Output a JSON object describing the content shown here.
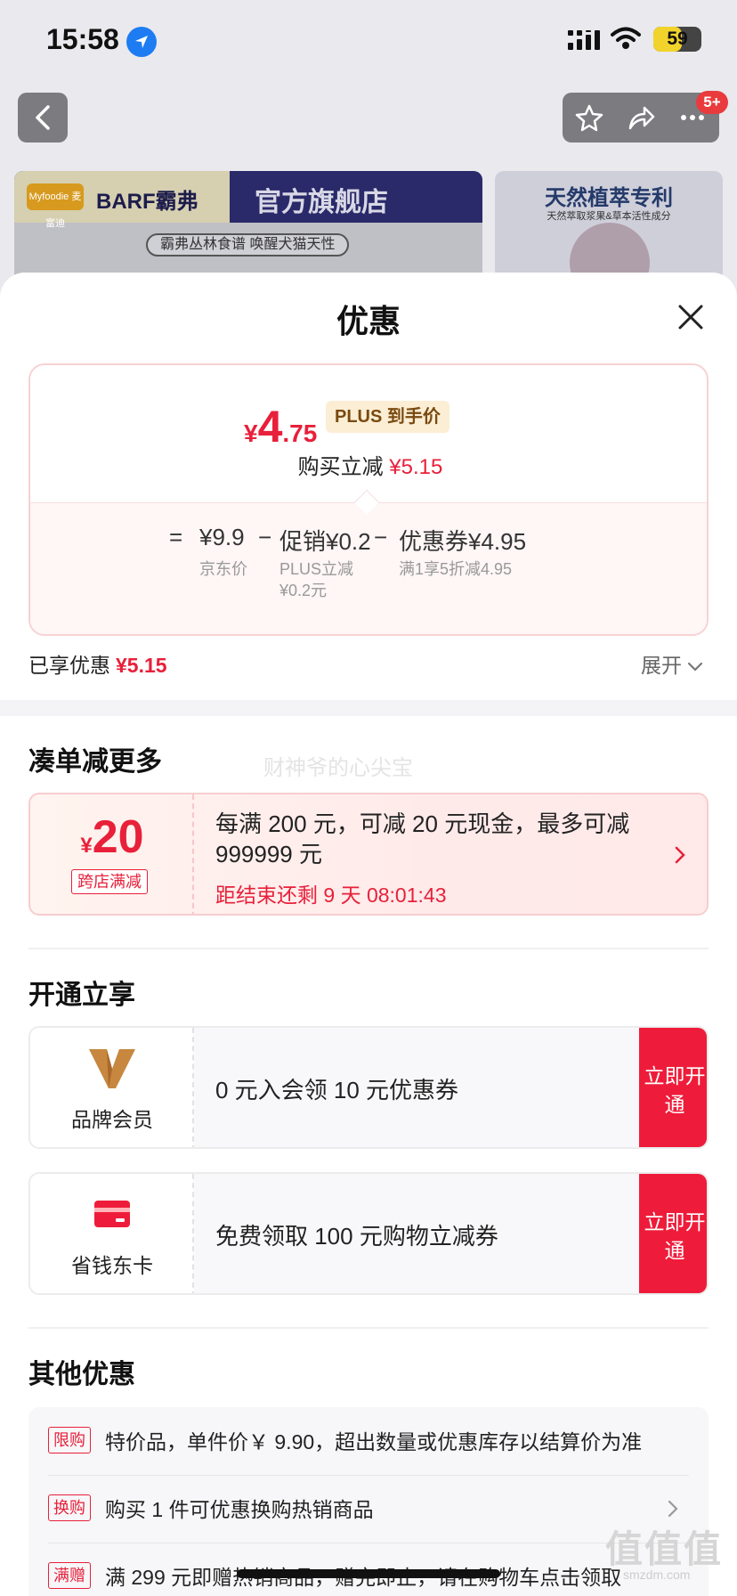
{
  "status_bar": {
    "time": "15:58",
    "battery": "59",
    "battery_level": 0.59
  },
  "nav": {
    "badge": "5+"
  },
  "background_banner": {
    "logo_small": "Myfoodie 麦富迪",
    "logo_brand": "BARF霸弗",
    "title": "官方旗舰店",
    "subtitle": "霸弗丛林食谱 唤醒犬猫天性",
    "side_title": "天然植萃专利",
    "side_subtitle": "天然萃取浆果&草本活性成分"
  },
  "sheet": {
    "title": "优惠"
  },
  "price_card": {
    "currency": "¥",
    "final_int": "4",
    "final_dec": ".75",
    "plus_tag": "PLUS 到手价",
    "instant_label": "购买立减",
    "instant_value": "¥5.15",
    "calc": {
      "eq": "=",
      "jd_price": "¥9.9",
      "jd_label": "京东价",
      "minus1": "−",
      "promo": "促销¥0.2",
      "promo_label": "PLUS立减",
      "promo_label2": "¥0.2元",
      "minus2": "−",
      "coupon": "优惠券¥4.95",
      "coupon_label": "满1享5折减4.95"
    }
  },
  "enjoyed": {
    "label": "已享优惠",
    "value": "¥5.15",
    "expand": "展开"
  },
  "sections": {
    "combine": "凑单减更多",
    "open": "开通立享",
    "other": "其他优惠"
  },
  "watermark": "财神爷的心尖宝",
  "cross_store_coupon": {
    "yen": "¥",
    "amount": "20",
    "tag": "跨店满减",
    "text": "每满 200 元，可减 20 元现金，最多可减 999999 元",
    "countdown": "距结束还剩 9 天 08:01:43"
  },
  "memberships": [
    {
      "name": "品牌会员",
      "text": "0 元入会领 10 元优惠券",
      "button": "立即开通"
    },
    {
      "name": "省钱东卡",
      "text": "免费领取 100 元购物立减券",
      "button": "立即开通"
    }
  ],
  "other_offers": [
    {
      "tag": "限购",
      "text": "特价品，单件价￥ 9.90，超出数量或优惠库存以结算价为准"
    },
    {
      "tag": "换购",
      "text": "购买 1 件可优惠换购热销商品"
    },
    {
      "tag": "满赠",
      "text": "满 299 元即赠热销商品，赠完即止，请在购物车点击领取"
    }
  ],
  "site_watermark": {
    "main": "值值值",
    "sub": "smzdm.com"
  },
  "colors": {
    "accent_red": "#e8203a",
    "button_red": "#ee1c3a",
    "plus_gold": "#fbeed4"
  }
}
